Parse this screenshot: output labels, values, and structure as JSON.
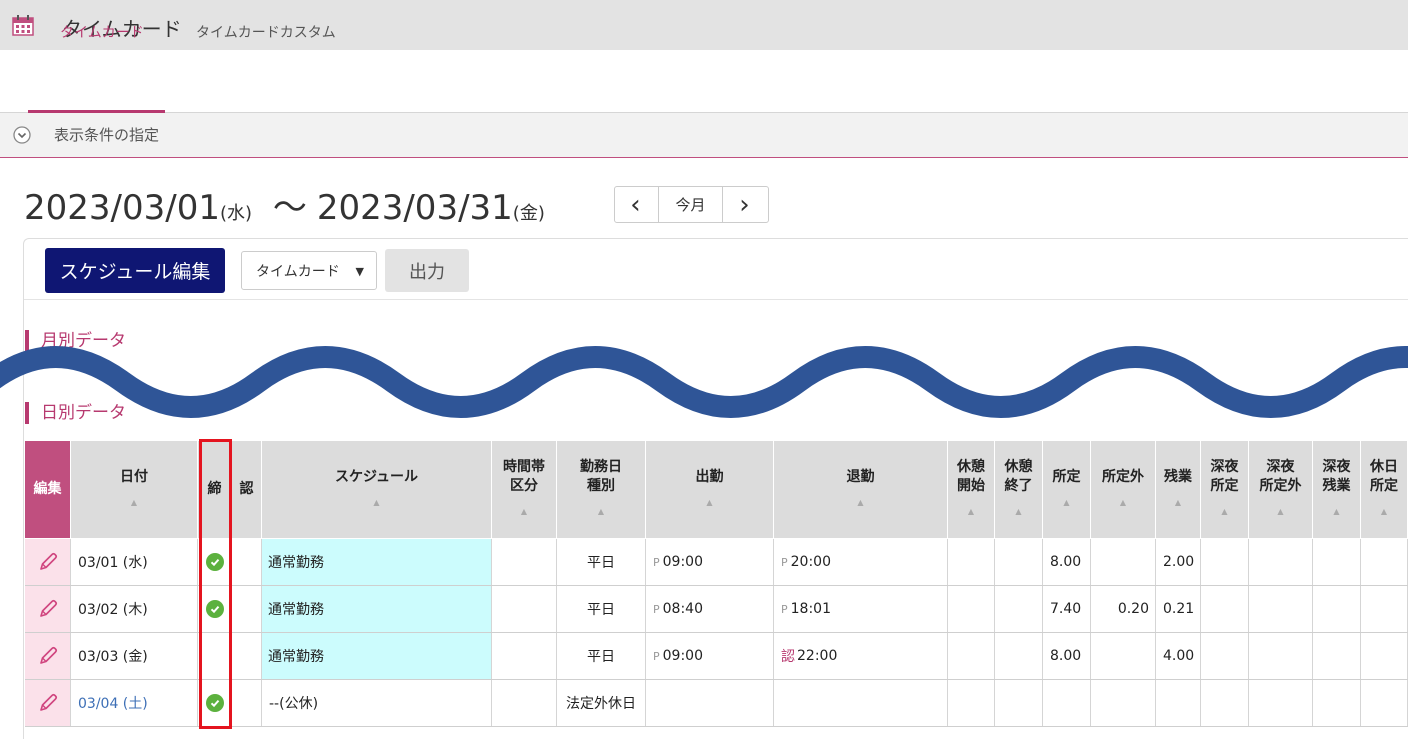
{
  "app": {
    "title": "タイムカード",
    "icon": "calendar-icon"
  },
  "tabs": [
    {
      "label": "タイムカード",
      "active": true
    },
    {
      "label": "タイムカードカスタム",
      "active": false
    }
  ],
  "filter": {
    "label": "表示条件の指定"
  },
  "range": {
    "start": "2023/03/01",
    "start_dow": "(水)",
    "tilde": "〜",
    "end": "2023/03/31",
    "end_dow": "(金)"
  },
  "nav": {
    "prev": "‹",
    "current": "今月",
    "next": "›"
  },
  "toolbar": {
    "schedule_button": "スケジュール編集",
    "type_select": "タイムカード",
    "output_button": "出力"
  },
  "sections": {
    "monthly": "月別データ",
    "daily": "日別データ"
  },
  "table": {
    "headers": {
      "edit": "編集",
      "date": "日付",
      "closed": "締",
      "approved": "認",
      "schedule": "スケジュール",
      "timeslot_1": "時間帯",
      "timeslot_2": "区分",
      "daytype_1": "勤務日",
      "daytype_2": "種別",
      "clock_in": "出勤",
      "clock_out": "退勤",
      "break_start_1": "休憩",
      "break_start_2": "開始",
      "break_end_1": "休憩",
      "break_end_2": "終了",
      "regular": "所定",
      "non_regular": "所定外",
      "overtime": "残業",
      "night_regular_1": "深夜",
      "night_regular_2": "所定",
      "night_nonreg_1": "深夜",
      "night_nonreg_2": "所定外",
      "night_overtime_1": "深夜",
      "night_overtime_2": "残業",
      "holiday_regular_1": "休日",
      "holiday_regular_2": "所定"
    },
    "rows": [
      {
        "date": "03/01 (水)",
        "closed": true,
        "schedule": "通常勤務",
        "daytype": "平日",
        "in_mark": "P",
        "clock_in": "09:00",
        "out_mark": "P",
        "clock_out": "20:00",
        "regular": "8.00",
        "non_regular": "",
        "overtime": "2.00"
      },
      {
        "date": "03/02 (木)",
        "closed": true,
        "schedule": "通常勤務",
        "daytype": "平日",
        "in_mark": "P",
        "clock_in": "08:40",
        "out_mark": "P",
        "clock_out": "18:01",
        "regular": "7.40",
        "non_regular": "0.20",
        "overtime": "0.21"
      },
      {
        "date": "03/03 (金)",
        "closed": false,
        "schedule": "通常勤務",
        "daytype": "平日",
        "in_mark": "P",
        "clock_in": "09:00",
        "out_mark": "認",
        "clock_out": "22:00",
        "regular": "8.00",
        "non_regular": "",
        "overtime": "4.00"
      },
      {
        "date": "03/04 (土)",
        "closed": true,
        "schedule": "--(公休)",
        "daytype": "法定外休日",
        "in_mark": "",
        "clock_in": "",
        "out_mark": "",
        "clock_out": "",
        "regular": "",
        "non_regular": "",
        "overtime": ""
      }
    ]
  },
  "colors": {
    "accent": "#b7396f",
    "primary_button": "#0f1673",
    "check": "#5cb13e",
    "highlight_box": "#e4141f",
    "wave": "#2f5597"
  }
}
